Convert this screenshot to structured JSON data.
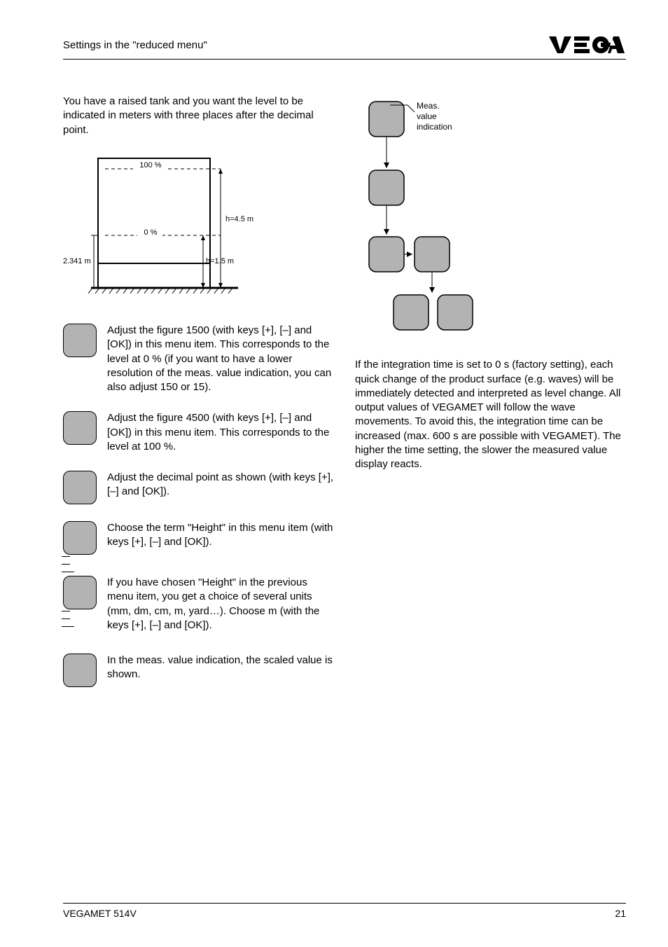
{
  "header": {
    "title": "Settings in the \"reduced menu\""
  },
  "left": {
    "intro": "You have a raised tank and you want the level to be indicated in meters with three places after the decimal point.",
    "tank": {
      "label100": "100 %",
      "label0": "0 %",
      "h45": "h=4.5 m",
      "h15": "h=1.5 m",
      "leftHeight": "2.341 m"
    },
    "item1": "Adjust the figure 1500 (with keys [+], [–] and [OK]) in this menu item. This corresponds to the level at 0 % (if you want to have a lower resolution of the meas. value indication, you can also adjust 150 or 15).",
    "item2": "Adjust the figure 4500 (with keys [+], [–] and [OK]) in this menu item. This corresponds to the level at 100 %.",
    "item3": "Adjust the decimal point as shown (with keys [+], [–] and [OK]).",
    "item4": "Choose the term \"Height\" in this menu item (with keys [+], [–] and [OK]).",
    "item5": "If you have chosen \"Height\" in the previous menu item, you get a choice of several units (mm, dm, cm, m, yard…). Choose m (with the keys [+], [–] and [OK]).",
    "item6": "In the meas. value indication, the scaled value is shown."
  },
  "right": {
    "flowLabel": "Meas.\nvalue\nindication",
    "para": "If the integration time is set to 0 s (factory setting), each quick change of the product surface (e.g. waves) will be immediately detected and interpreted as level change. All output values of VEGAMET will follow the wave movements. To avoid this, the integration time can be increased (max. 600 s are possible with VEGAMET). The higher the time setting, the slower the measured value display reacts."
  },
  "footer": {
    "left": "VEGAMET 514V",
    "right": "21"
  }
}
